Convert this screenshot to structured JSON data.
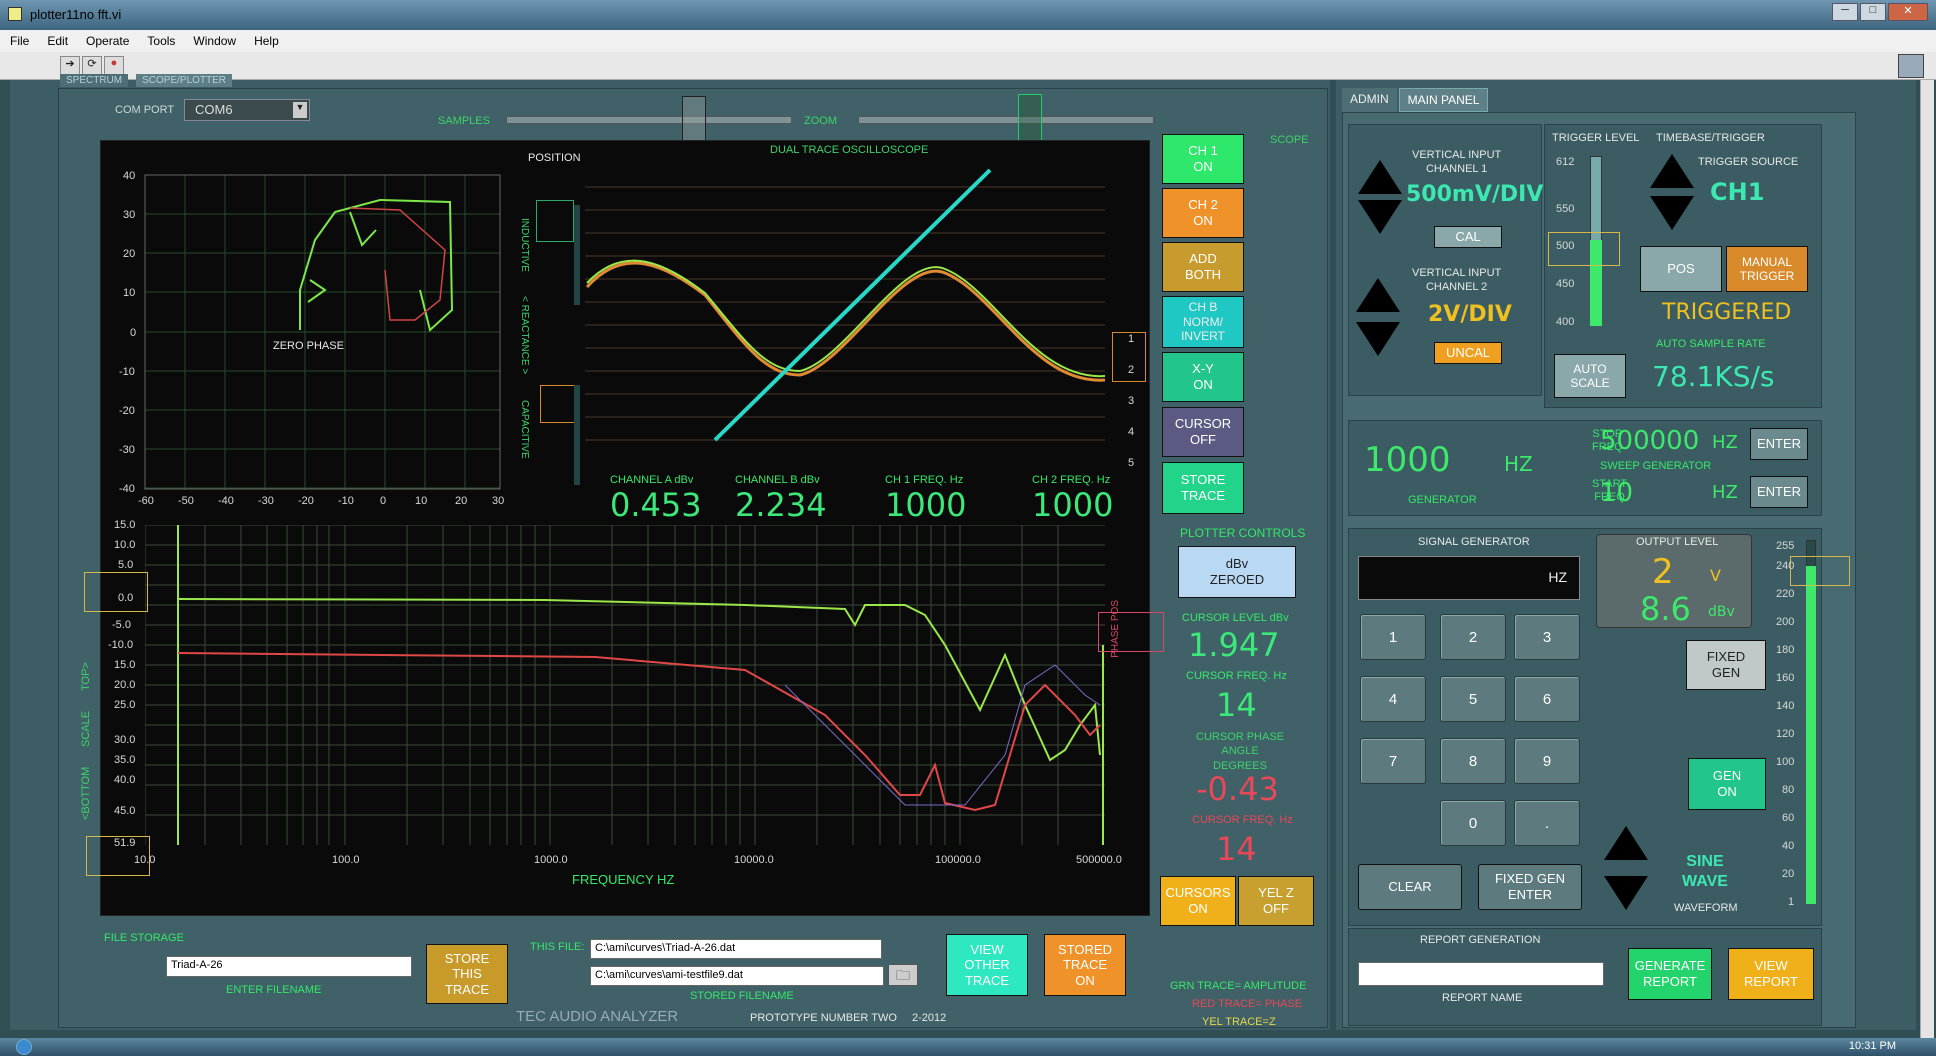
{
  "window": {
    "title": "plotter11no fft.vi"
  },
  "menu": [
    "File",
    "Edit",
    "Operate",
    "Tools",
    "Window",
    "Help"
  ],
  "left_tabs": [
    "SPECTRUM",
    "SCOPE/PLOTTER"
  ],
  "com_port": {
    "label": "COM PORT",
    "value": "COM6"
  },
  "sliders": {
    "samples": "SAMPLES",
    "zoom": "ZOOM"
  },
  "xy_plot": {
    "position_label": "POSITION",
    "annotation": "ZERO PHASE",
    "y_ticks": [
      "40",
      "30",
      "20",
      "10",
      "0",
      "-10",
      "-20",
      "-30",
      "-40"
    ],
    "x_ticks": [
      "-60",
      "-50",
      "-40",
      "-30",
      "-20",
      "-10",
      "0",
      "10",
      "20",
      "30"
    ],
    "side_labels": [
      "INDUCTIVE",
      "< REACTANCE >",
      "CAPACITIVE"
    ]
  },
  "scope": {
    "title": "DUAL TRACE OSCILLOSCOPE",
    "scope_label": "SCOPE",
    "right_ticks": [
      "1",
      "2",
      "3",
      "4",
      "5"
    ],
    "readouts": [
      {
        "label": "CHANNEL A dBv",
        "value": "0.453"
      },
      {
        "label": "CHANNEL B dBv",
        "value": "2.234"
      },
      {
        "label": "CH 1 FREQ. Hz",
        "value": "1000"
      },
      {
        "label": "CH 2 FREQ. Hz",
        "value": "1000"
      }
    ]
  },
  "scope_buttons": [
    {
      "label": "CH 1\nON",
      "color": "#2de86b"
    },
    {
      "label": "CH 2\nON",
      "color": "#f0922a"
    },
    {
      "label": "ADD\nBOTH",
      "color": "#c79b2e"
    },
    {
      "label": "CH B\nNORM/\nINVERT",
      "color": "#20c8c4"
    },
    {
      "label": "X-Y\nON",
      "color": "#22c68a"
    },
    {
      "label": "CURSOR\nOFF",
      "color": "#5a5a82"
    },
    {
      "label": "STORE\nTRACE",
      "color": "#22d48a"
    }
  ],
  "plotter": {
    "y_ticks": [
      "15.0",
      "10.0",
      "5.0",
      "0.0",
      "-5.0",
      "-10.0",
      "15.0",
      "20.0",
      "25.0",
      "30.0",
      "35.0",
      "40.0",
      "45.0"
    ],
    "y_bottom": "51.9",
    "x_ticks": [
      "10.0",
      "100.0",
      "1000.0",
      "10000.0",
      "100000.0",
      "500000.0"
    ],
    "xlabel": "FREQUENCY HZ",
    "left_labels": [
      "<BOTTOM",
      "SCALE",
      "TOP>"
    ],
    "phase_label": "PHASE POS"
  },
  "plotter_controls": {
    "title": "PLOTTER CONTROLS",
    "zero_btn": "dBv\nZEROED",
    "cursor_level_label": "CURSOR LEVEL dBv",
    "cursor_level": "1.947",
    "cursor_freq_label": "CURSOR FREQ. Hz",
    "cursor_freq": "14",
    "phase_label": "CURSOR PHASE\nANGLE\nDEGREES",
    "phase": "-0.43",
    "cursor_freq2_label": "CURSOR FREQ. Hz",
    "cursor_freq2": "14",
    "cursors_btn": "CURSORS\nON",
    "yelz_btn": "YEL Z\nOFF"
  },
  "legend": {
    "grn": "GRN TRACE= AMPLITUDE",
    "red": "RED TRACE= PHASE",
    "yel": "YEL TRACE=Z"
  },
  "file_storage": {
    "title": "FILE STORAGE",
    "filename": "Triad-A-26",
    "enter_label": "ENTER FILENAME",
    "store_btn": "STORE\nTHIS\nTRACE",
    "this_file_label": "THIS FILE:",
    "this_file": "C:\\ami\\curves\\Triad-A-26.dat",
    "stored_file": "C:\\ami\\curves\\ami-testfile9.dat",
    "stored_label": "STORED FILENAME",
    "view_btn": "VIEW\nOTHER\nTRACE",
    "stored_btn": "STORED\nTRACE\nON"
  },
  "footer": {
    "brand": "TEC AUDIO ANALYZER",
    "proto": "PROTOTYPE NUMBER TWO",
    "date": "2-2012"
  },
  "right_tabs": [
    "ADMIN",
    "MAIN PANEL"
  ],
  "vertical": {
    "ch1_label": "VERTICAL INPUT\nCHANNEL 1",
    "ch1_value": "500mV/DIV",
    "cal": "CAL",
    "ch2_label": "VERTICAL INPUT\nCHANNEL 2",
    "ch2_value": "2V/DIV",
    "uncal": "UNCAL"
  },
  "trigger": {
    "level_label": "TRIGGER LEVEL",
    "ticks": [
      "612",
      "550",
      "500",
      "450",
      "400"
    ],
    "auto_scale": "AUTO\nSCALE",
    "timebase_label": "TIMEBASE/TRIGGER",
    "source_label": "TRIGGER SOURCE",
    "source": "CH1",
    "pos": "POS",
    "manual": "MANUAL\nTRIGGER",
    "status": "TRIGGERED",
    "rate_label": "AUTO SAMPLE RATE",
    "rate": "78.1KS/s"
  },
  "generator": {
    "freq": "1000",
    "hz": "HZ",
    "label": "GENERATOR",
    "stop_label": "STOP\nFREQ",
    "stop": "500000",
    "start_label": "START\nFREQ",
    "start": "10",
    "sweep_label": "SWEEP GENERATOR",
    "enter": "ENTER"
  },
  "signal_gen": {
    "title": "SIGNAL GENERATOR",
    "display_unit": "HZ",
    "keys": [
      "1",
      "2",
      "3",
      "4",
      "5",
      "6",
      "7",
      "8",
      "9",
      "0",
      "."
    ],
    "clear": "CLEAR",
    "fixed_enter": "FIXED GEN\nENTER",
    "waveform": "SINE\nWAVE",
    "waveform_label": "WAVEFORM"
  },
  "output": {
    "title": "OUTPUT LEVEL",
    "volts": "2",
    "v": "V",
    "dbv": "8.6",
    "dbv_unit": "dBv",
    "fixed_gen": "FIXED\nGEN",
    "gen_on": "GEN\nON",
    "ticks": [
      "255",
      "240",
      "220",
      "200",
      "180",
      "160",
      "140",
      "120",
      "100",
      "80",
      "60",
      "40",
      "20",
      "1"
    ]
  },
  "report": {
    "title": "REPORT GENERATION",
    "name_label": "REPORT NAME",
    "generate": "GENERATE\nREPORT",
    "view": "VIEW\nREPORT"
  },
  "clock": "10:31 PM"
}
